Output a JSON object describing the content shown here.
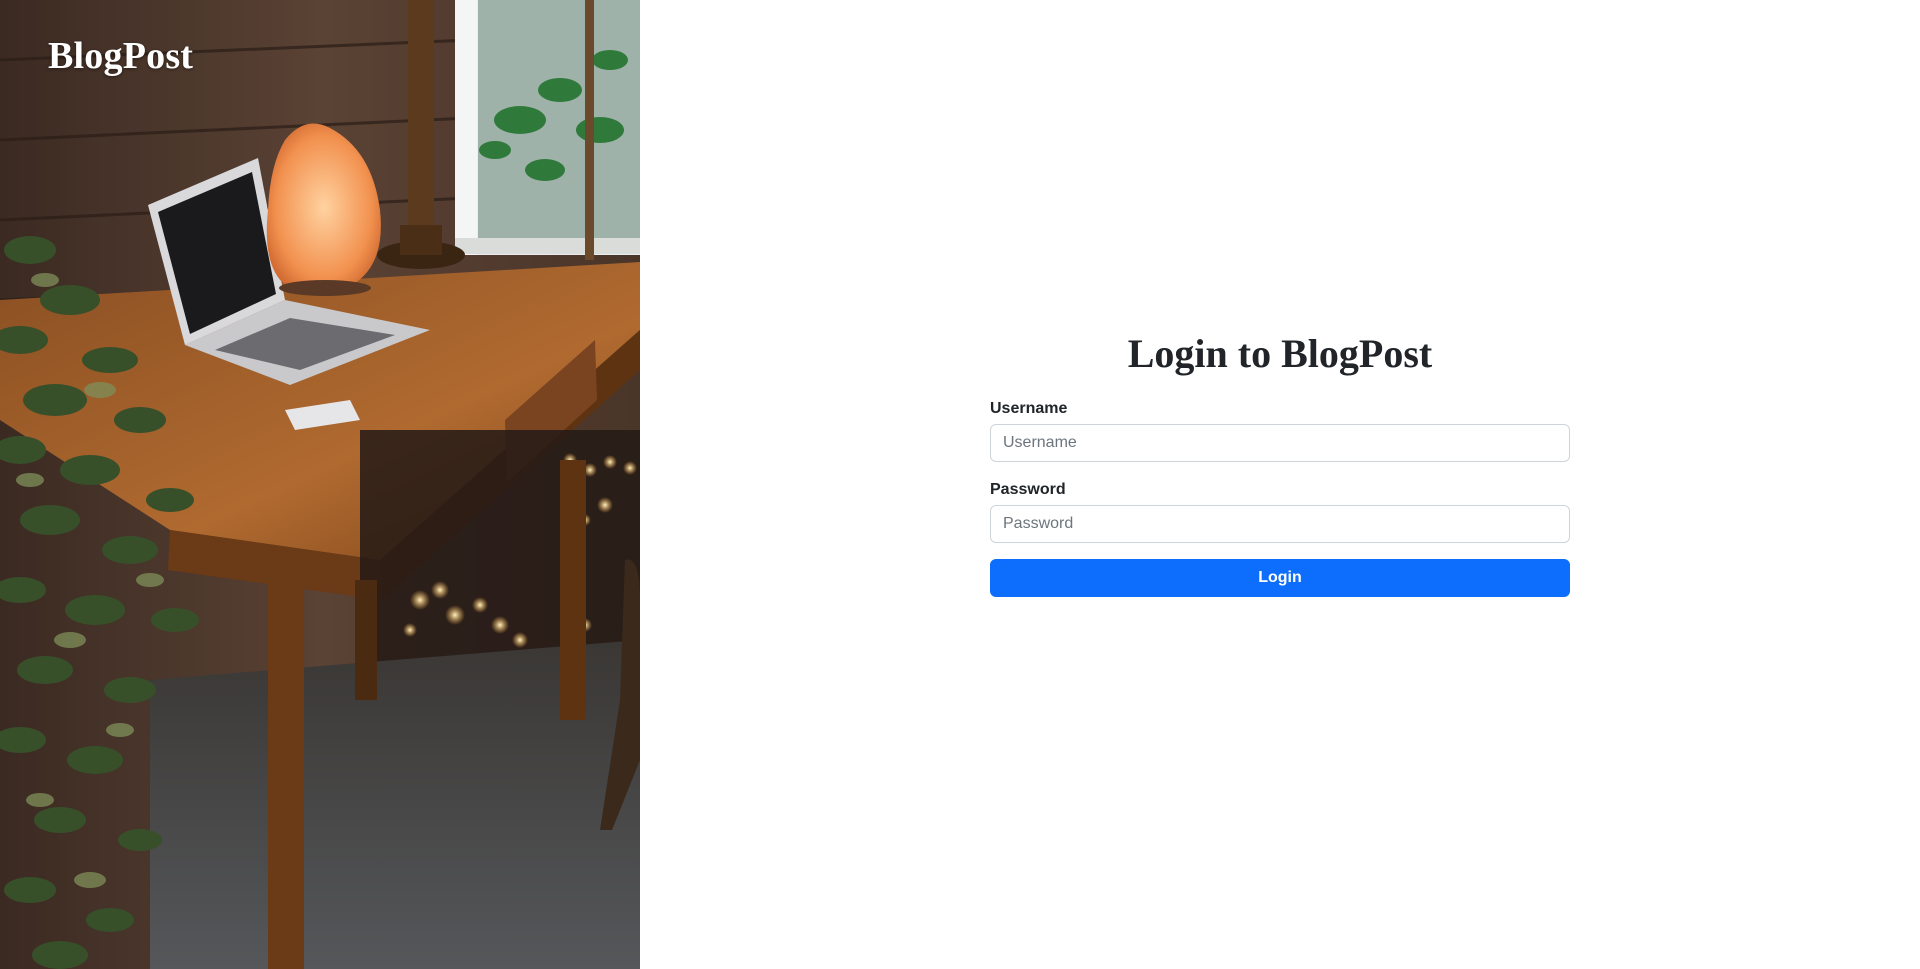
{
  "brand": {
    "name": "BlogPost"
  },
  "hero_image": {
    "subject": "wooden desk with laptop, salt lamp, candle holder, ivy plant and string lights"
  },
  "login": {
    "title": "Login to BlogPost",
    "username": {
      "label": "Username",
      "placeholder": "Username",
      "value": ""
    },
    "password": {
      "label": "Password",
      "placeholder": "Password",
      "value": ""
    },
    "submit_label": "Login"
  },
  "colors": {
    "primary": "#0d6efd",
    "text": "#212529",
    "input_border": "#ced4da",
    "placeholder": "#6c757d",
    "background": "#ffffff"
  }
}
